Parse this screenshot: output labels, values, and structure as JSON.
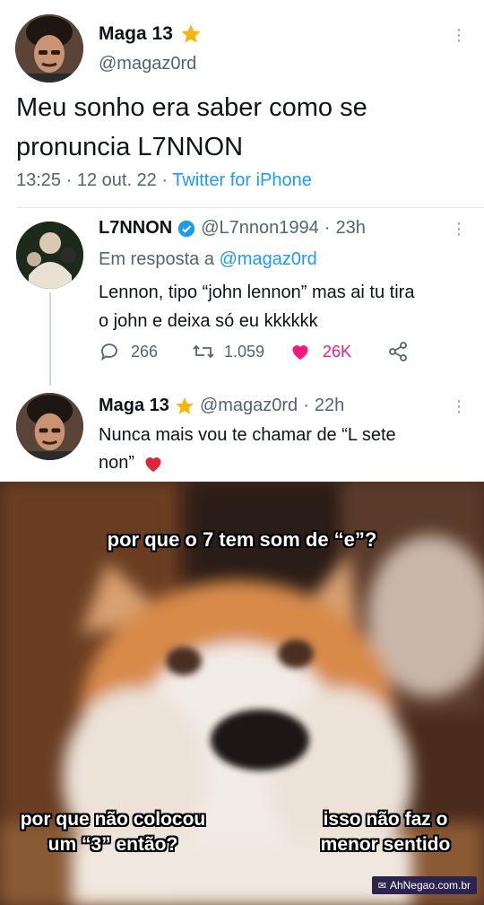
{
  "tweet": {
    "author_name": "Maga 13",
    "author_handle": "@magaz0rd",
    "text_line1": "Meu sonho era saber como se",
    "text_line2": "pronuncia L7NNON",
    "time": "13:25",
    "date": "12 out. 22",
    "source": "Twitter for iPhone"
  },
  "reply1": {
    "author_name": "L7NNON",
    "author_handle": "@L7nnon1994",
    "age": "23h",
    "reply_prefix": "Em resposta a",
    "reply_to": "@magaz0rd",
    "text_line1": "Lennon, tipo “john lennon” mas ai tu tira",
    "text_line2": "o john e deixa só eu kkkkkk",
    "replies": "266",
    "retweets": "1.059",
    "likes": "26K"
  },
  "reply2": {
    "author_name": "Maga 13",
    "author_handle": "@magaz0rd",
    "age": "22h",
    "text_line1": "Nunca mais vou te chamar de “L sete",
    "text_line2": "non”"
  },
  "meme": {
    "caption_top": "por que o 7 tem som de “e”?",
    "caption_left_1": "por que não colocou",
    "caption_left_2": "um “3” então?",
    "caption_right_1": "isso não faz o",
    "caption_right_2": "menor sentido",
    "watermark": "AhNegao.com.br"
  },
  "colors": {
    "link": "#1d9bf0",
    "like": "#f91880",
    "star": "#f5b50a",
    "verified": "#1d9bf0",
    "muted": "#536471"
  }
}
